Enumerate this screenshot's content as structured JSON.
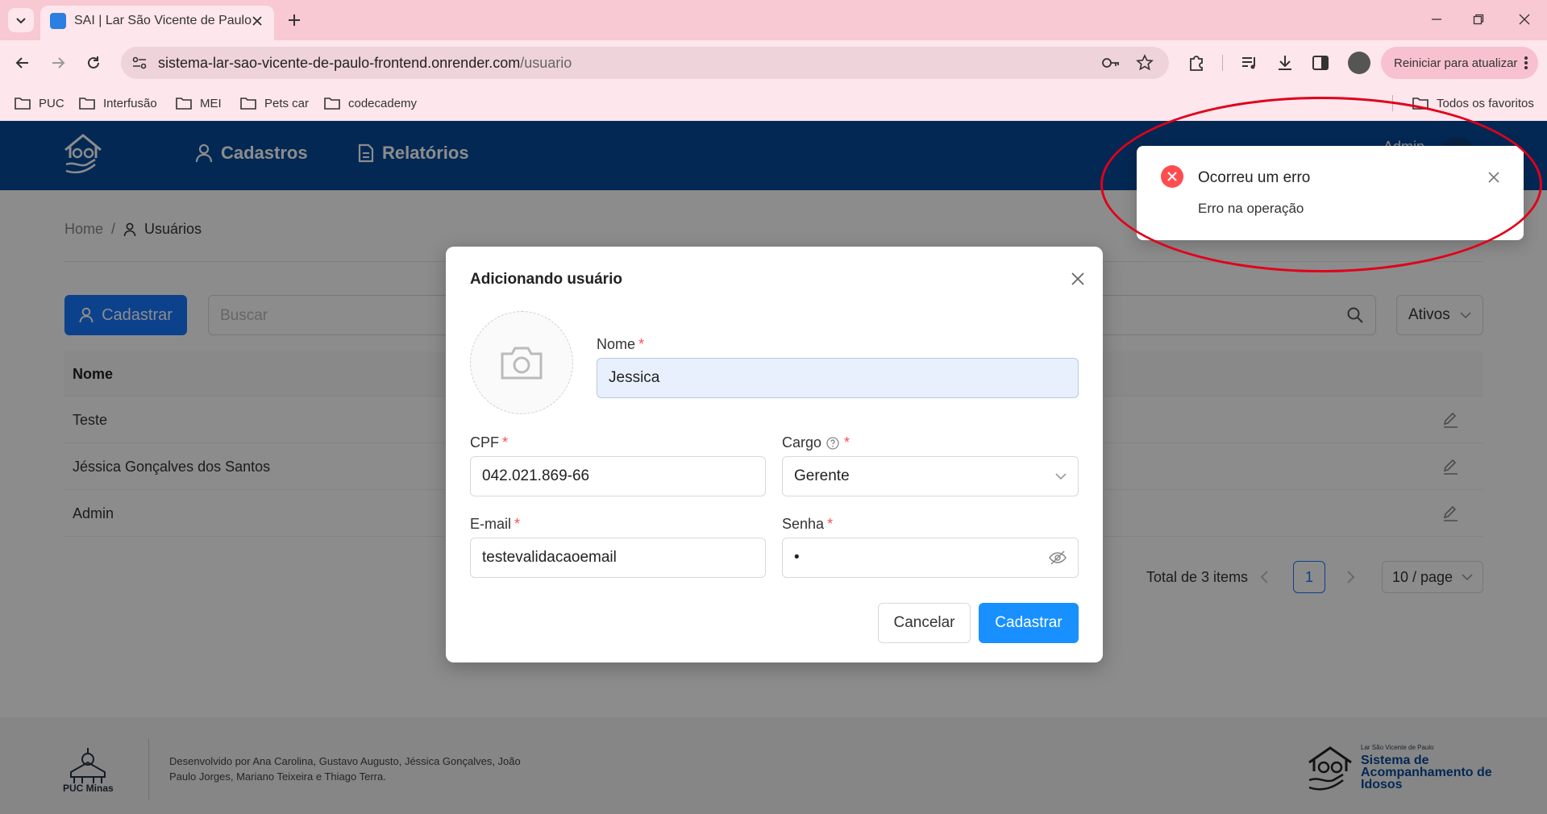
{
  "browser": {
    "tab_title": "SAI | Lar São Vicente de Paulo",
    "url_host": "sistema-lar-sao-vicente-de-paulo-frontend.onrender.com",
    "url_path": "/usuario",
    "restart_label": "Reiniciar para atualizar",
    "bookmarks": [
      "PUC",
      "Interfusão",
      "MEI",
      "Pets car",
      "codecademy"
    ],
    "all_bookmarks": "Todos os favoritos"
  },
  "header": {
    "nav": [
      {
        "label": "Cadastros",
        "icon": "user-icon"
      },
      {
        "label": "Relatórios",
        "icon": "document-icon"
      }
    ],
    "user_label": "Admin"
  },
  "breadcrumb": {
    "home": "Home",
    "separator": "/",
    "current": "Usuários"
  },
  "toolbar": {
    "add_button": "Cadastrar",
    "search_placeholder": "Buscar",
    "filter_value": "Ativos"
  },
  "table": {
    "columns": [
      "Nome"
    ],
    "rows": [
      {
        "name": "Teste"
      },
      {
        "name": "Jéssica Gonçalves dos Santos"
      },
      {
        "name": "Admin"
      }
    ]
  },
  "pagination": {
    "total": "Total de 3 items",
    "current_page": "1",
    "page_size": "10 / page"
  },
  "footer": {
    "credits": "Desenvolvido por Ana Carolina, Gustavo Augusto, Jéssica Gonçalves, João Paulo Jorges, Mariano Teixeira e Thiago Terra.",
    "puc_name": "PUC Minas",
    "sai_small": "Lar São Vicente de Paulo",
    "sai_name": "Sistema de Acompanhamento de Idosos"
  },
  "modal": {
    "title": "Adicionando usuário",
    "fields": {
      "nome": {
        "label": "Nome",
        "value": "Jessica"
      },
      "cpf": {
        "label": "CPF",
        "value": "042.021.869-66"
      },
      "cargo": {
        "label": "Cargo",
        "value": "Gerente"
      },
      "email": {
        "label": "E-mail",
        "value": "testevalidacaoemail"
      },
      "senha": {
        "label": "Senha",
        "value": "•"
      }
    },
    "required_mark": "*",
    "cancel_label": "Cancelar",
    "submit_label": "Cadastrar"
  },
  "notification": {
    "title": "Ocorreu um erro",
    "description": "Erro na operação",
    "type": "error",
    "color": "#ff4d4f"
  },
  "colors": {
    "header": "#064a99",
    "primary": "#1677ff",
    "annotation": "#e0001b"
  }
}
